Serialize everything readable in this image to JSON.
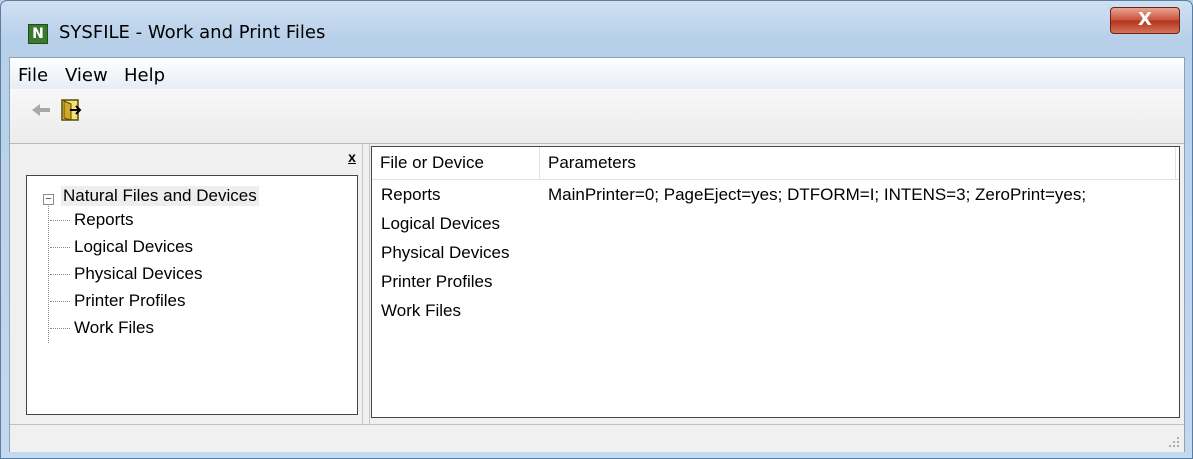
{
  "window": {
    "title": "SYSFILE - Work and Print Files",
    "icon_letter": "N",
    "close_glyph": "X"
  },
  "menu": [
    "File",
    "View",
    "Help"
  ],
  "toolbar": {
    "back_icon": "back-arrow-icon",
    "exit_icon": "exit-door-icon"
  },
  "left_pane": {
    "close_glyph": "x",
    "tree": {
      "root": "Natural Files and Devices",
      "toggle": "−",
      "children": [
        "Reports",
        "Logical Devices",
        "Physical Devices",
        "Printer Profiles",
        "Work Files"
      ]
    }
  },
  "list": {
    "columns": [
      "File or Device",
      "Parameters"
    ],
    "rows": [
      {
        "name": "Reports",
        "params": "MainPrinter=0; PageEject=yes; DTFORM=I; INTENS=3; ZeroPrint=yes;"
      },
      {
        "name": "Logical Devices",
        "params": ""
      },
      {
        "name": "Physical Devices",
        "params": ""
      },
      {
        "name": "Printer Profiles",
        "params": ""
      },
      {
        "name": "Work Files",
        "params": ""
      }
    ]
  },
  "statusbar": {
    "text": ""
  }
}
